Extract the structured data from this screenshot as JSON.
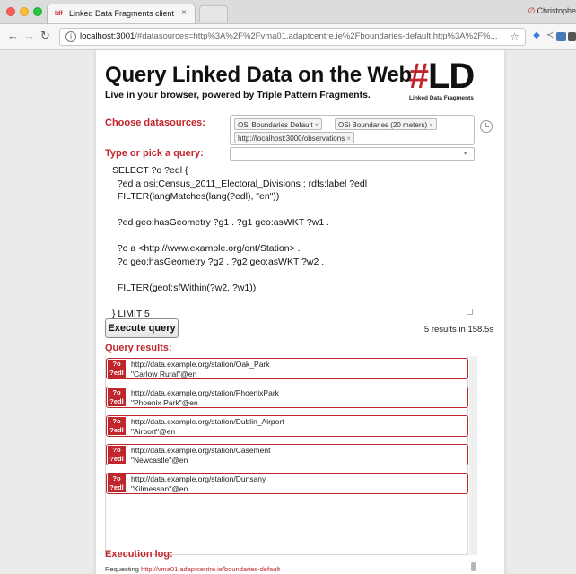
{
  "browser": {
    "tab_title": "Linked Data Fragments client",
    "tab_favicon": "ldf",
    "tab_close": "×",
    "profile_name": "Christophe",
    "url_host": "localhost:3001",
    "url_path": "/#datasources=http%3A%2F%2Fvma01.adaptcentre.ie%2Fboundaries-default;http%3A%2F%...",
    "icons": [
      "back-icon",
      "forward-icon",
      "reload-icon",
      "info-icon",
      "star-icon"
    ]
  },
  "header": {
    "title": "Query Linked Data on the Web",
    "subtitle": "Live in your browser, powered by Triple Pattern Fragments.",
    "logo_hash": "#",
    "logo_ld": "LD",
    "logo_caption": "Linked Data Fragments"
  },
  "datasources": {
    "label": "Choose datasources:",
    "chips": [
      "OSi Boundaries Default",
      "OSi Boundaries (20 meters)",
      "http://localhost:3000/observations"
    ],
    "chip_remove": "×"
  },
  "query": {
    "label": "Type or pick a query:",
    "select_value": "",
    "lines": [
      "SELECT ?o ?edl {",
      "  ?ed a osi:Census_2011_Electoral_Divisions ; rdfs:label ?edl .",
      "  FILTER(langMatches(lang(?edl), \"en\"))",
      "",
      "  ?ed geo:hasGeometry ?g1 . ?g1 geo:asWKT ?w1 .",
      "",
      "  ?o a <http://www.example.org/ont/Station> .",
      "  ?o geo:hasGeometry ?g2 . ?g2 geo:asWKT ?w2 .",
      "",
      "  FILTER(geof:sfWithin(?w2, ?w1))",
      "",
      "} LIMIT 5"
    ]
  },
  "execute": {
    "button_label": "Execute query",
    "status": "5 results in 158.5s"
  },
  "results": {
    "label": "Query results:",
    "var_o": "?o",
    "var_edl": "?edl",
    "items": [
      {
        "o": "http://data.example.org/station/Oak_Park",
        "edl": "\"Carlow Rural\"@en"
      },
      {
        "o": "http://data.example.org/station/PhoenixPark",
        "edl": "\"Phoenix Park\"@en"
      },
      {
        "o": "http://data.example.org/station/Dublin_Airport",
        "edl": "\"Airport\"@en"
      },
      {
        "o": "http://data.example.org/station/Casement",
        "edl": "\"Newcastle\"@en"
      },
      {
        "o": "http://data.example.org/station/Dunsany",
        "edl": "\"Kilmessan\"@en"
      }
    ]
  },
  "log": {
    "label": "Execution log:",
    "prefix": "Requesting ",
    "link": "http://vma01.adaptcentre.ie/boundaries-default"
  },
  "colors": {
    "accent": "#c0272d",
    "chrome": "#dcdcdc"
  }
}
